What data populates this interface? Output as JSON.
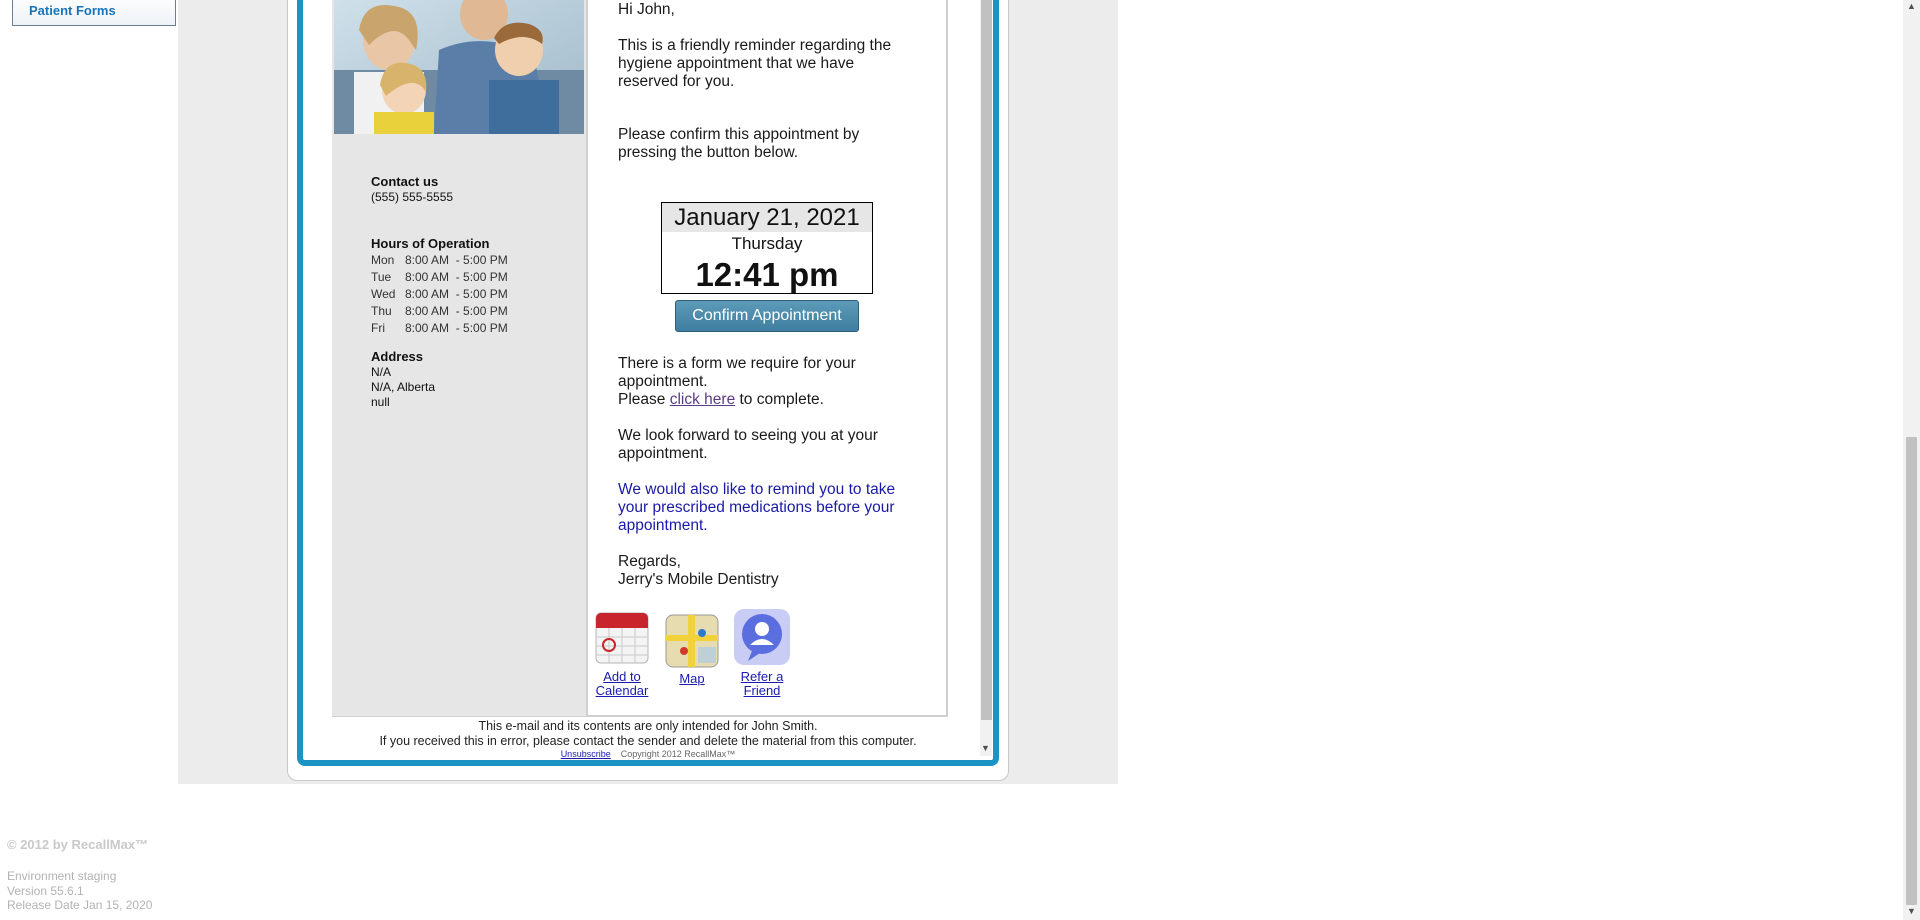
{
  "sidebar": {
    "patient_forms_label": "Patient Forms"
  },
  "email": {
    "greeting": "Hi John,",
    "reminder": "This is a friendly reminder regarding the hygiene appointment that we have reserved for you.",
    "confirm_prompt": "Please confirm this appointment by pressing the button below.",
    "appointment": {
      "date": "January 21, 2021",
      "day": "Thursday",
      "time": "12:41 pm"
    },
    "confirm_button": "Confirm Appointment",
    "form_text_1": "There is a form we require for your appointment.",
    "form_text_please": "Please",
    "form_link": "click here",
    "form_text_2": "to complete.",
    "look_forward": "We look forward to seeing you at your appointment.",
    "medication_reminder": "We would also like to remind you to take your prescribed medications before your appointment.",
    "regards": "Regards,",
    "practice_name": "Jerry's Mobile Dentistry",
    "icons": {
      "calendar_label_1": "Add to",
      "calendar_label_2": "Calendar",
      "map_label": "Map",
      "refer_label_1": "Refer a",
      "refer_label_2": "Friend"
    },
    "contact": {
      "heading": "Contact us",
      "phone": "(555) 555-5555"
    },
    "hours": {
      "heading": "Hours of Operation",
      "rows": [
        {
          "day": "Mon",
          "time": "8:00 AM  - 5:00 PM"
        },
        {
          "day": "Tue",
          "time": "8:00 AM  - 5:00 PM"
        },
        {
          "day": "Wed",
          "time": "8:00 AM  - 5:00 PM"
        },
        {
          "day": "Thu",
          "time": "8:00 AM  - 5:00 PM"
        },
        {
          "day": "Fri",
          "time": "8:00 AM  - 5:00 PM"
        }
      ]
    },
    "address": {
      "heading": "Address",
      "line1": "N/A",
      "line2": "N/A, Alberta",
      "line3": "null"
    },
    "footer": {
      "intended": "This e-mail and its contents are only intended for John Smith.",
      "error_notice": "If you received this in error, please contact the sender and delete the material from this computer.",
      "unsubscribe": "Unsubscribe",
      "copyright": "Copyright 2012 RecallMax™"
    }
  },
  "page_footer": {
    "copyright": "© 2012 by RecallMax™",
    "environment": "Environment staging",
    "version": "Version 55.6.1",
    "release": "Release Date Jan 15, 2020"
  },
  "colors": {
    "frame_blue": "#1b94c4",
    "button": "#4a88aa",
    "medication_text": "#1a1aa8"
  }
}
